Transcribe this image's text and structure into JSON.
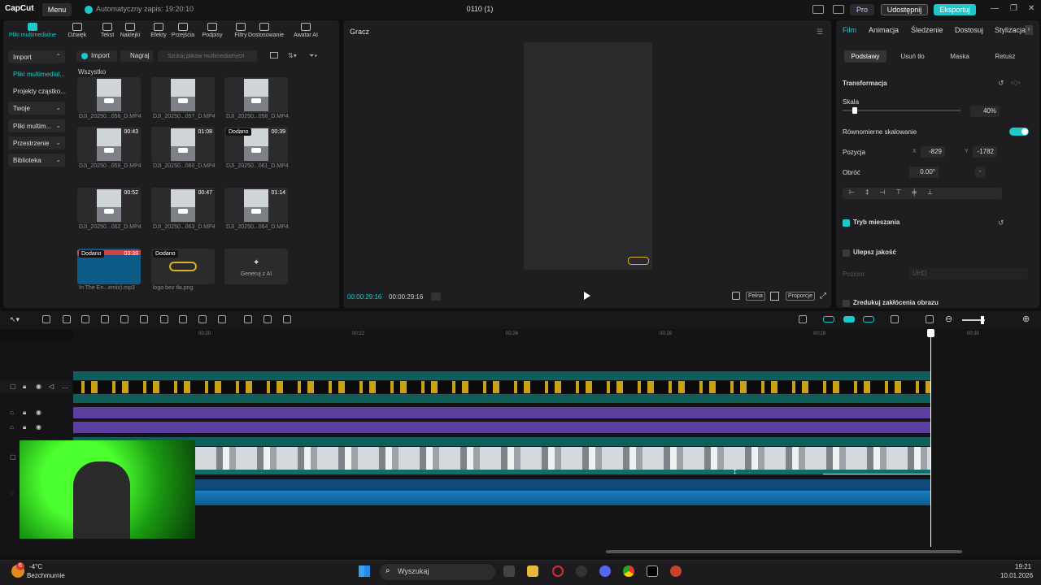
{
  "app": {
    "logo": "CapCut",
    "menu": "Menu",
    "autosave": "Automatyczny zapis: 19:20:10",
    "title": "0110 (1)",
    "pro": "Pro",
    "share": "Udostępnij",
    "export": "Eksportuj"
  },
  "media_tools": [
    "Pliki multimedialne",
    "Dźwięk",
    "Tekst",
    "Naklejki",
    "Efekty",
    "Przejścia",
    "Podpisy",
    "Filtry",
    "Dostosowanie",
    "Awatar AI"
  ],
  "sidebar": [
    "Import",
    "Pliki multimedial...",
    "Projekty cząstko...",
    "Twoje",
    "Pliki multim...",
    "Przestrzenie",
    "Biblioteka"
  ],
  "media_bar": {
    "import": "Import",
    "record": "Nagraj",
    "search_placeholder": "Szukaj plików multimedialnych"
  },
  "media_section": "Wszystko",
  "media": [
    {
      "name": "DJI_20250...056_D.MP4",
      "dur": "",
      "badge": ""
    },
    {
      "name": "DJI_20250...057_D.MP4",
      "dur": "",
      "badge": ""
    },
    {
      "name": "DJI_20250...058_D.MP4",
      "dur": "",
      "badge": ""
    },
    {
      "name": "DJI_20250...059_D.MP4",
      "dur": "00:43",
      "badge": ""
    },
    {
      "name": "DJI_20250...060_D.MP4",
      "dur": "01:08",
      "badge": ""
    },
    {
      "name": "DJI_20250...061_D.MP4",
      "dur": "00:39",
      "badge": "Dodano"
    },
    {
      "name": "DJI_20250...062_D.MP4",
      "dur": "00:52",
      "badge": ""
    },
    {
      "name": "DJI_20250...063_D.MP4",
      "dur": "00:47",
      "badge": ""
    },
    {
      "name": "DJI_20250...064_D.MP4",
      "dur": "01:14",
      "badge": ""
    },
    {
      "name": "In The En...emix).mp3",
      "dur": "03:39",
      "badge": "Dodano"
    },
    {
      "name": "logo bez tła.png",
      "dur": "",
      "badge": "Dodano"
    }
  ],
  "generate_ai": "Generuj z AI",
  "player": {
    "title": "Gracz",
    "time_current": "00:00:29:16",
    "time_total": "00:00:29:16",
    "full": "Pełna",
    "ratio": "Proporcje"
  },
  "props": {
    "tabs": [
      "Film",
      "Animacja",
      "Śledzenie",
      "Dostosuj",
      "Stylizacja"
    ],
    "subtabs": [
      "Podstawy",
      "Usuń tło",
      "Maska",
      "Retusz"
    ],
    "transform": "Transformacja",
    "scale_label": "Skala",
    "scale_value": "40%",
    "scale_fraction": 0.4,
    "uniform": "Równomierne skalowanie",
    "position_label": "Pozycja",
    "x_label": "X",
    "x_value": "-829",
    "y_label": "Y",
    "y_value": "-1782",
    "rotate_label": "Obróć",
    "rotate_value": "0.00°",
    "blend": "Tryb mieszania",
    "enhance": "Ulepsz jakość",
    "level_label": "Poziom",
    "level_value": "UHD",
    "denoise": "Zredukuj zakłócenia obrazu"
  },
  "ruler": [
    "00:20",
    "00:22",
    "00:24",
    "00:26",
    "00:28",
    "00:30"
  ],
  "taskbar": {
    "temp": "-4°C",
    "weather": "Bezchmurnie",
    "search": "Wyszukaj",
    "time": "19:21",
    "date": "10.01.2026",
    "notif": "6"
  }
}
